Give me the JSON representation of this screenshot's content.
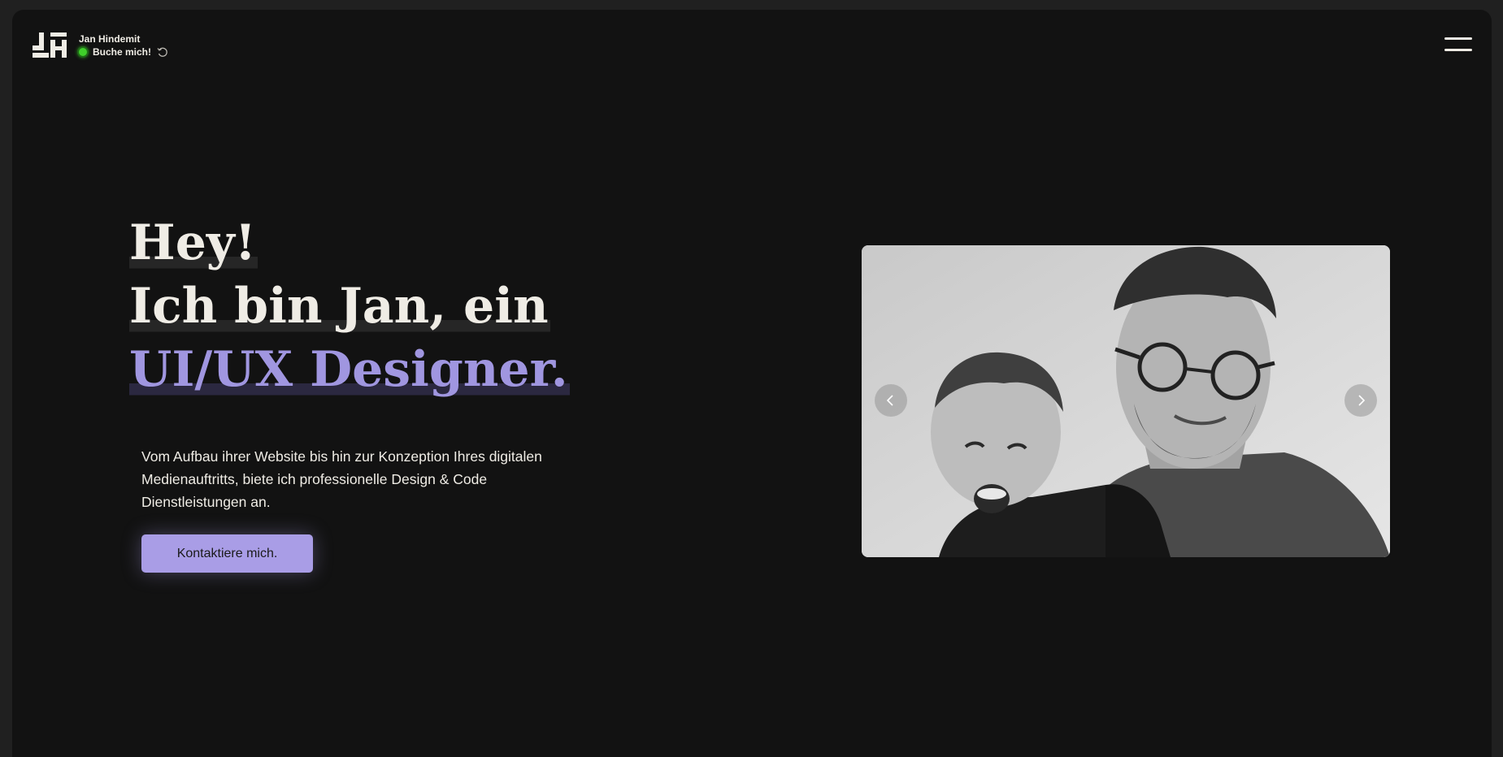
{
  "header": {
    "logo_icon": "jh-monogram-logo",
    "name": "Jan Hindemit",
    "status_label": "Buche mich!",
    "status_color": "#3fcf2a",
    "status_icon": "refresh-icon",
    "menu_icon": "hamburger-menu-icon"
  },
  "hero": {
    "line1": "Hey!",
    "line2": "Ich bin Jan, ein",
    "line3": "UI/UX Designer.",
    "description": "Vom Aufbau ihrer Website bis hin zur Konzeption Ihres digitalen Medienauftritts, biete ich professionelle Design & Code Dienstleistungen an.",
    "cta_label": "Kontaktiere mich."
  },
  "carousel": {
    "prev_icon": "chevron-left-icon",
    "next_icon": "chevron-right-icon"
  },
  "colors": {
    "background": "#121212",
    "text": "#efece5",
    "accent": "#a096e0",
    "cta": "#a99de6"
  }
}
